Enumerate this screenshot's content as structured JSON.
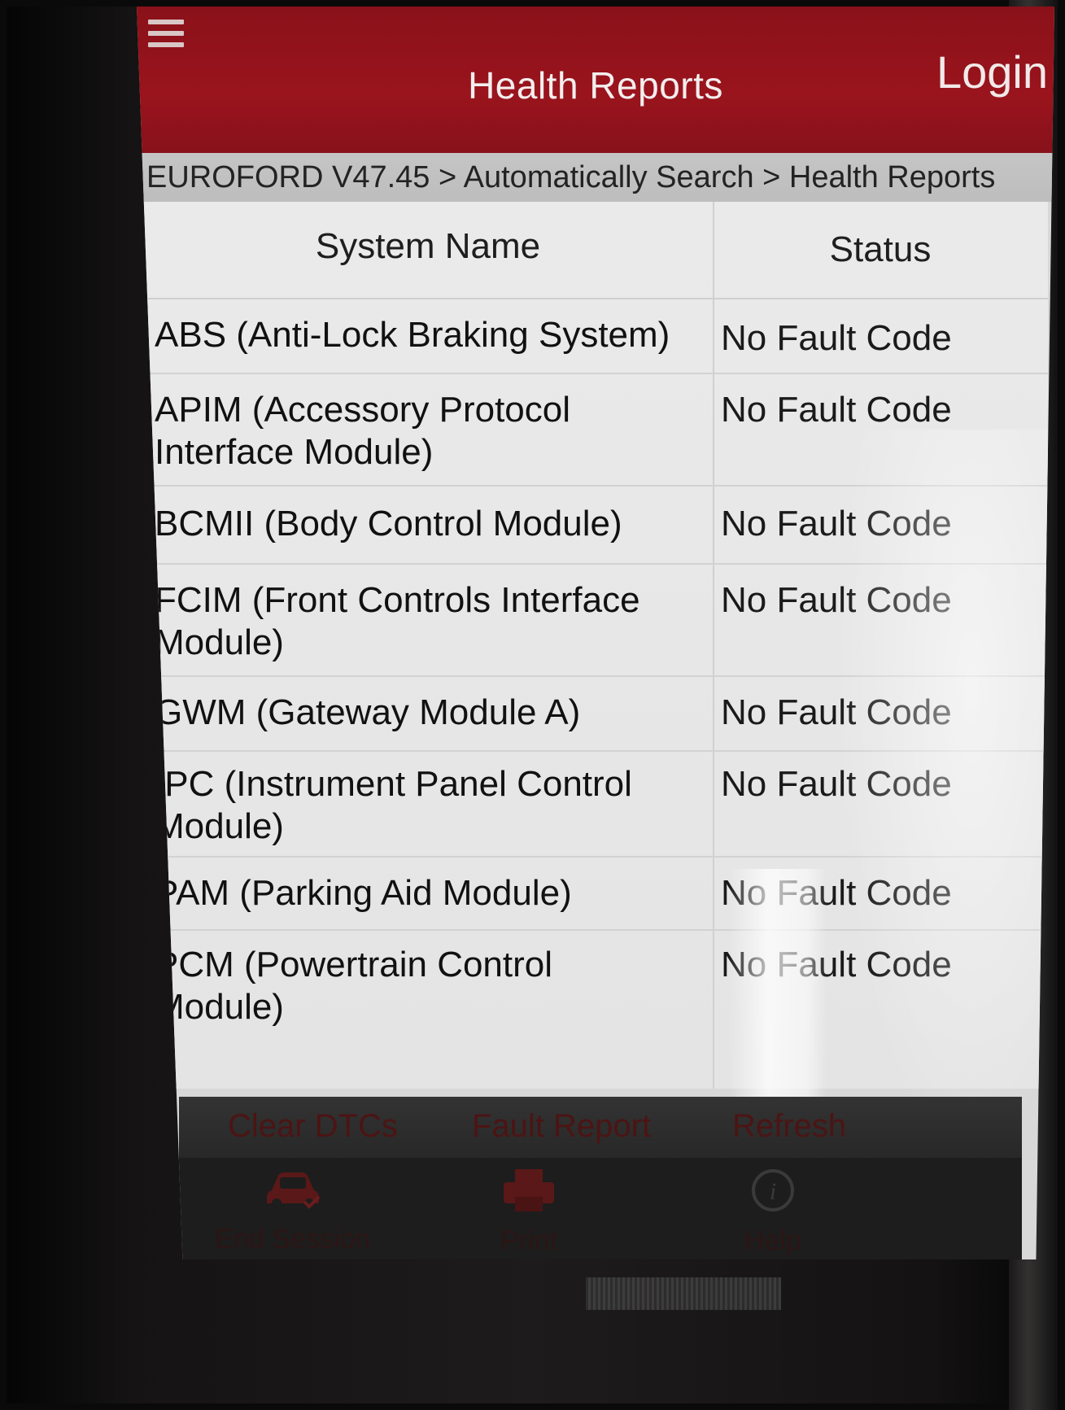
{
  "header": {
    "title": "Health Reports",
    "login_label": "Login"
  },
  "breadcrumb": "EUROFORD V47.45 > Automatically Search > Health Reports",
  "table": {
    "columns": [
      "System Name",
      "Status"
    ],
    "rows": [
      {
        "name": "ABS (Anti-Lock Braking System)",
        "status": "No Fault Code"
      },
      {
        "name": "APIM (Accessory Protocol Interface Module)",
        "status": "No Fault Code"
      },
      {
        "name": "BCMII (Body Control Module)",
        "status": "No Fault Code"
      },
      {
        "name": "FCIM (Front Controls Interface Module)",
        "status": "No Fault Code"
      },
      {
        "name": "GWM (Gateway Module A)",
        "status": "No Fault Code"
      },
      {
        "name": "IPC (Instrument Panel Control Module)",
        "status": "No Fault Code"
      },
      {
        "name": "PAM (Parking Aid Module)",
        "status": "No Fault Code"
      },
      {
        "name": "PCM (Powertrain Control Module)",
        "status": "No Fault Code"
      }
    ]
  },
  "actions": {
    "clear_dtcs": "Clear DTCs",
    "fault_report": "Fault Report",
    "refresh": "Refresh"
  },
  "bottom_nav": [
    {
      "label": "End Session",
      "icon": "car-check-icon"
    },
    {
      "label": "Print",
      "icon": "printer-icon"
    },
    {
      "label": "Help",
      "icon": "info-icon"
    }
  ],
  "colors": {
    "header_red": "#9a141d",
    "accent_red": "#c11a24"
  }
}
